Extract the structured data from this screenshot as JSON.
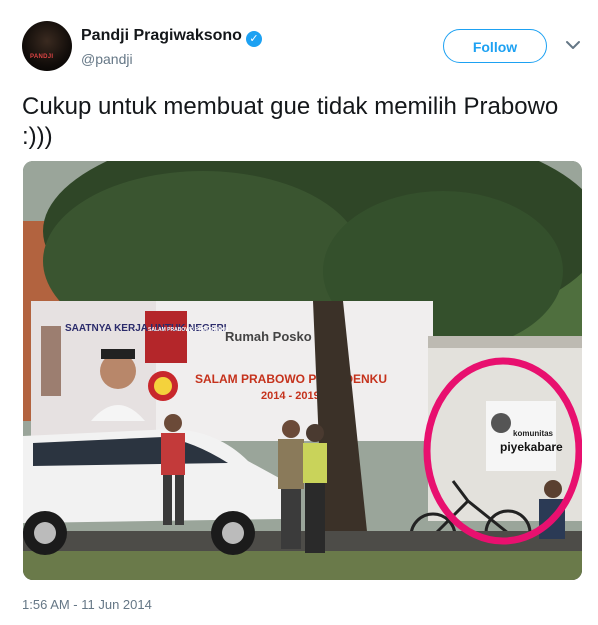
{
  "author": {
    "display_name": "Pandji Pragiwaksono",
    "handle": "@pandji",
    "avatar_text": "PANDJI"
  },
  "follow_button": {
    "label": "Follow"
  },
  "tweet": {
    "text": "Cukup untuk membuat gue tidak memilih Prabowo :)))",
    "timestamp": "1:56 AM - 11 Jun 2014"
  },
  "photo": {
    "banner_headline": "SAATNYA KERJA UNTUK NEGERI",
    "banner_badge": "SALAM PRABOWO PRESIDENKU",
    "banner_title": "Rumah Posko",
    "banner_slogan": "SALAM PRABOWO PRESIDENKU",
    "banner_years": "2014 - 2019",
    "small_sign_line1": "komunitas",
    "small_sign_line2": "piyekabare",
    "highlight_color": "#e8106f"
  },
  "colors": {
    "accent": "#1da1f2",
    "text": "#14171a",
    "muted": "#657786"
  }
}
